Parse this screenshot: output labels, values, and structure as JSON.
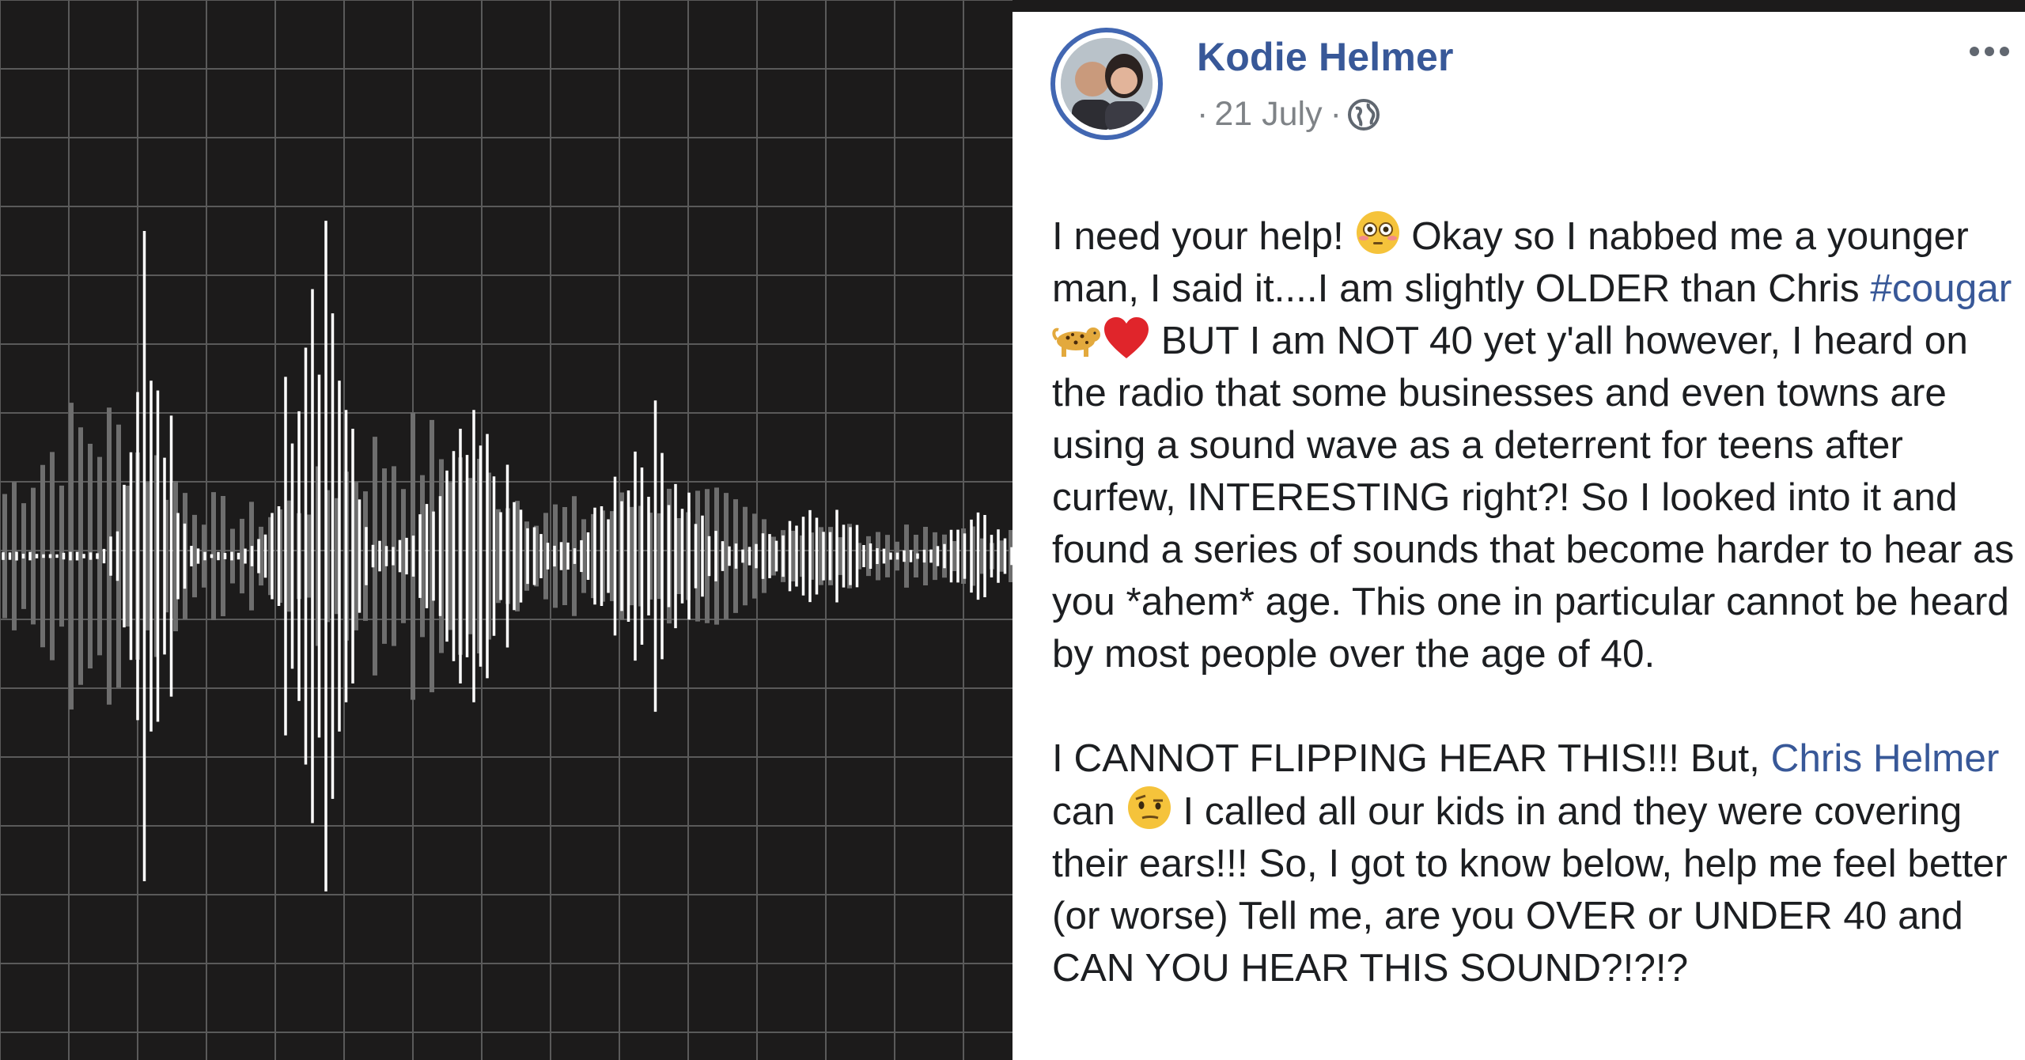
{
  "post": {
    "author": "Kodie Helmer",
    "date": "21 July",
    "meta_prefix": "·",
    "meta_sep": "·",
    "privacy_icon": "globe-icon",
    "more_icon": "more-options-icon",
    "paragraph1": {
      "part1": "I need your help! ",
      "emoji1": "flushed-face",
      "part2": " Okay so I nabbed me a younger man, I said it....I am slightly OLDER than Chris ",
      "hashtag": "#cougar",
      "emoji2": "leopard",
      "emoji3": "red-heart",
      "part3": " BUT I am NOT 40 yet y'all however, I heard on the radio that some businesses and even towns are using a sound wave as a deterrent for teens after curfew, INTERESTING right?! So I looked into it and found a series of sounds that become harder to hear as you *ahem* age. This one in particular cannot be heard by most people over the age of 40."
    },
    "paragraph2": {
      "part1": "I CANNOT FLIPPING HEAR THIS!!! But, ",
      "mention": "Chris Helmer",
      "part2": " can ",
      "emoji1": "face-with-raised-eyebrow",
      "part3": " I called all our kids in and they were covering their ears!!! So, I got to know below, help me feel better (or worse) Tell me, are you OVER or UNDER 40 and CAN YOU HEAR THIS SOUND?!?!?"
    }
  },
  "colors": {
    "background_dark": "#1c1b1b",
    "grid_line": "#5a5a5a",
    "wave_front": "#ffffff",
    "wave_back": "#6e6e6e",
    "link": "#385898",
    "avatar_ring": "#4267b2"
  }
}
